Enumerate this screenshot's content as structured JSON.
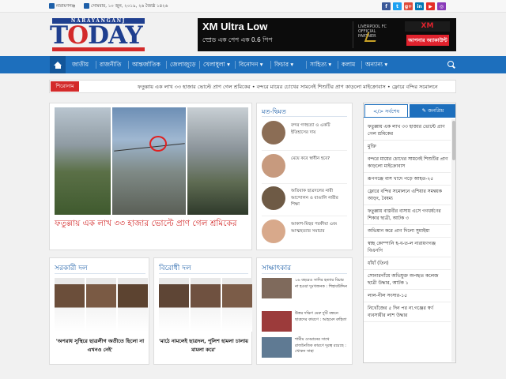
{
  "topbar": {
    "location": "নারায়ণগঞ্জ",
    "date": "সোমবার, ১০ জুন, ২০১৯, ২৬ জ্যৈষ্ঠ ১৪২৬",
    "social": [
      {
        "icon": "facebook-icon",
        "glyph": "f",
        "color": "#3b5998"
      },
      {
        "icon": "twitter-icon",
        "glyph": "t",
        "color": "#1da1f2"
      },
      {
        "icon": "google-plus-icon",
        "glyph": "g+",
        "color": "#dd4b39"
      },
      {
        "icon": "linkedin-icon",
        "glyph": "in",
        "color": "#0077b5"
      },
      {
        "icon": "youtube-icon",
        "glyph": "▶",
        "color": "#e52d27"
      },
      {
        "icon": "instagram-icon",
        "glyph": "◎",
        "color": "#8a3ab9"
      }
    ]
  },
  "logo": {
    "top": "NARAYANGANJ",
    "main_pre": "T",
    "main_o": "O",
    "main_post": "DAY"
  },
  "ad": {
    "title": "XM Ultra Low",
    "subtitle": "স্প্রেড এক পেপ এক 0.6 পিপ",
    "partner_label": "LIVERPOOL FC OFFICIAL PARTNER",
    "brand_pre": "",
    "brand_mark": "XM",
    "cta": "আপনার অ্যাকাউন্ট"
  },
  "nav": {
    "items": [
      "জাতীয়",
      "রাজনীতি",
      "আন্তর্জাতিক",
      "জেলাজুড়ে",
      "খেলাধুলা ▾",
      "বিনোদন ▾",
      "ফিচার ▾",
      "সাহিত্য ▾",
      "কলাম",
      "অন্যান্য ▾"
    ]
  },
  "ticker": {
    "label": "শিরোনাম",
    "text": "ফতুল্লায় এক লাখ ৩৩ হাজার ভোল্টে প্রাণ গেল শ্রমিকের  •  বন্দরে মায়ের চোখের সামনেই শিশুটির প্রাণ কাড়লো মাইক্রোবাস  •  ফ্লোরে বন্দির সমোলনে"
  },
  "hero": {
    "title": "ফতুল্লায় এক লাখ ৩৩ হাজার ভোল্টে প্রাণ গেল শ্রমিকের"
  },
  "opinion": {
    "title": "মত-দ্বিমত",
    "items": [
      {
        "text": "বন্দর গণহত্যা ও একটি ইতিহাসের দায়",
        "color": "#8b6d55"
      },
      {
        "text": "মেয়ে কবে স্বাধীন হবে?",
        "color": "#c79a7e"
      },
      {
        "text": "অতিবাক ছাত্রদলের নারী আন্দোলন ও বাঙালি নারীর শিক্ষা",
        "color": "#6e5a45"
      },
      {
        "text": "আকাশ-মিহুর পরকীয়া এবং আত্মহত্যার সমাচার",
        "color": "#d8a98b"
      }
    ]
  },
  "sidebar": {
    "tab_latest": "সর্বশেষ",
    "tab_popular": "জনপ্রিয়",
    "items": [
      "ফতুল্লায় এক লাখ ৩৩ হাজার ভোল্টে প্রাণ গেল শ্রমিকের",
      "মুক্তি",
      "বন্দরে মায়ের চোখের সামনেই শিশুটির প্রাণ কাড়লো মাইক্রোবাস",
      "রূপগঞ্জে বাস খাদে পড়ে আহত-২৫",
      "ফ্লোরে বন্দির সমোলনে এশিয়ার সমন্বয়ক আড়ং, বৈষম্য",
      "ফতুল্লায় বাস্তবীর বাসায় এসে গণধর্ষণের শিকার ছাত্রী, আটক ৩",
      "অভিমান করে প্রাণ দিলো সুমাইয়া",
      "স্বচ্ছ কোম্পানি হ-ব-ত-ল নারায়ণগঞ্জ বিএনপি",
      "ধাঁধাঁ (তিন)",
      "সোনারগাঁয়ে অভিযুক্ত অপহৃত কলেজ ছাত্রী উদ্ধার, আটক ১",
      "লাল-নীল সংসার-১৫",
      "নিখোঁজের ৫ দিন পর না.গঞ্জের স্বর্ণ ব্যবসায়ীর লাশ উদ্ধার"
    ]
  },
  "gov_party": {
    "title": "সরকারী দল",
    "caption": "'অপরাধ সুস্থিরে ছাত্রলীগ অতীতে ছিলো না এখনও নেই'",
    "faces": [
      "#6b4e3a",
      "#7a5a44",
      "#5c4330"
    ]
  },
  "opp_party": {
    "title": "বিরোধী দল",
    "caption": "'মাঠে নামলেই ছাত্রদল, পুলিশ হামলা চালায় মামলা করে'",
    "faces": [
      "#5e4535",
      "#6f5140",
      "#7b5c48"
    ]
  },
  "interview": {
    "title": "সাক্ষাৎকার",
    "items": [
      {
        "text": "১৬ বছরেও সাদির হত্যার বিচার না হওয়া দুঃখজনক : শিহাবউদ্দিন",
        "color": "#7f6a5c"
      },
      {
        "text": "উত্তর দক্ষিণ মেরু দুটি বন্ধনে ছাত্রদের কারণে : আহমেদ রুহিতা",
        "color": "#9c3b3b"
      },
      {
        "text": "শামীম ওসমানের সাথে রাজনৈতিক কারণে দূরত্ব রয়েছে : খোকন সাহা",
        "color": "#5f7a93"
      }
    ]
  }
}
